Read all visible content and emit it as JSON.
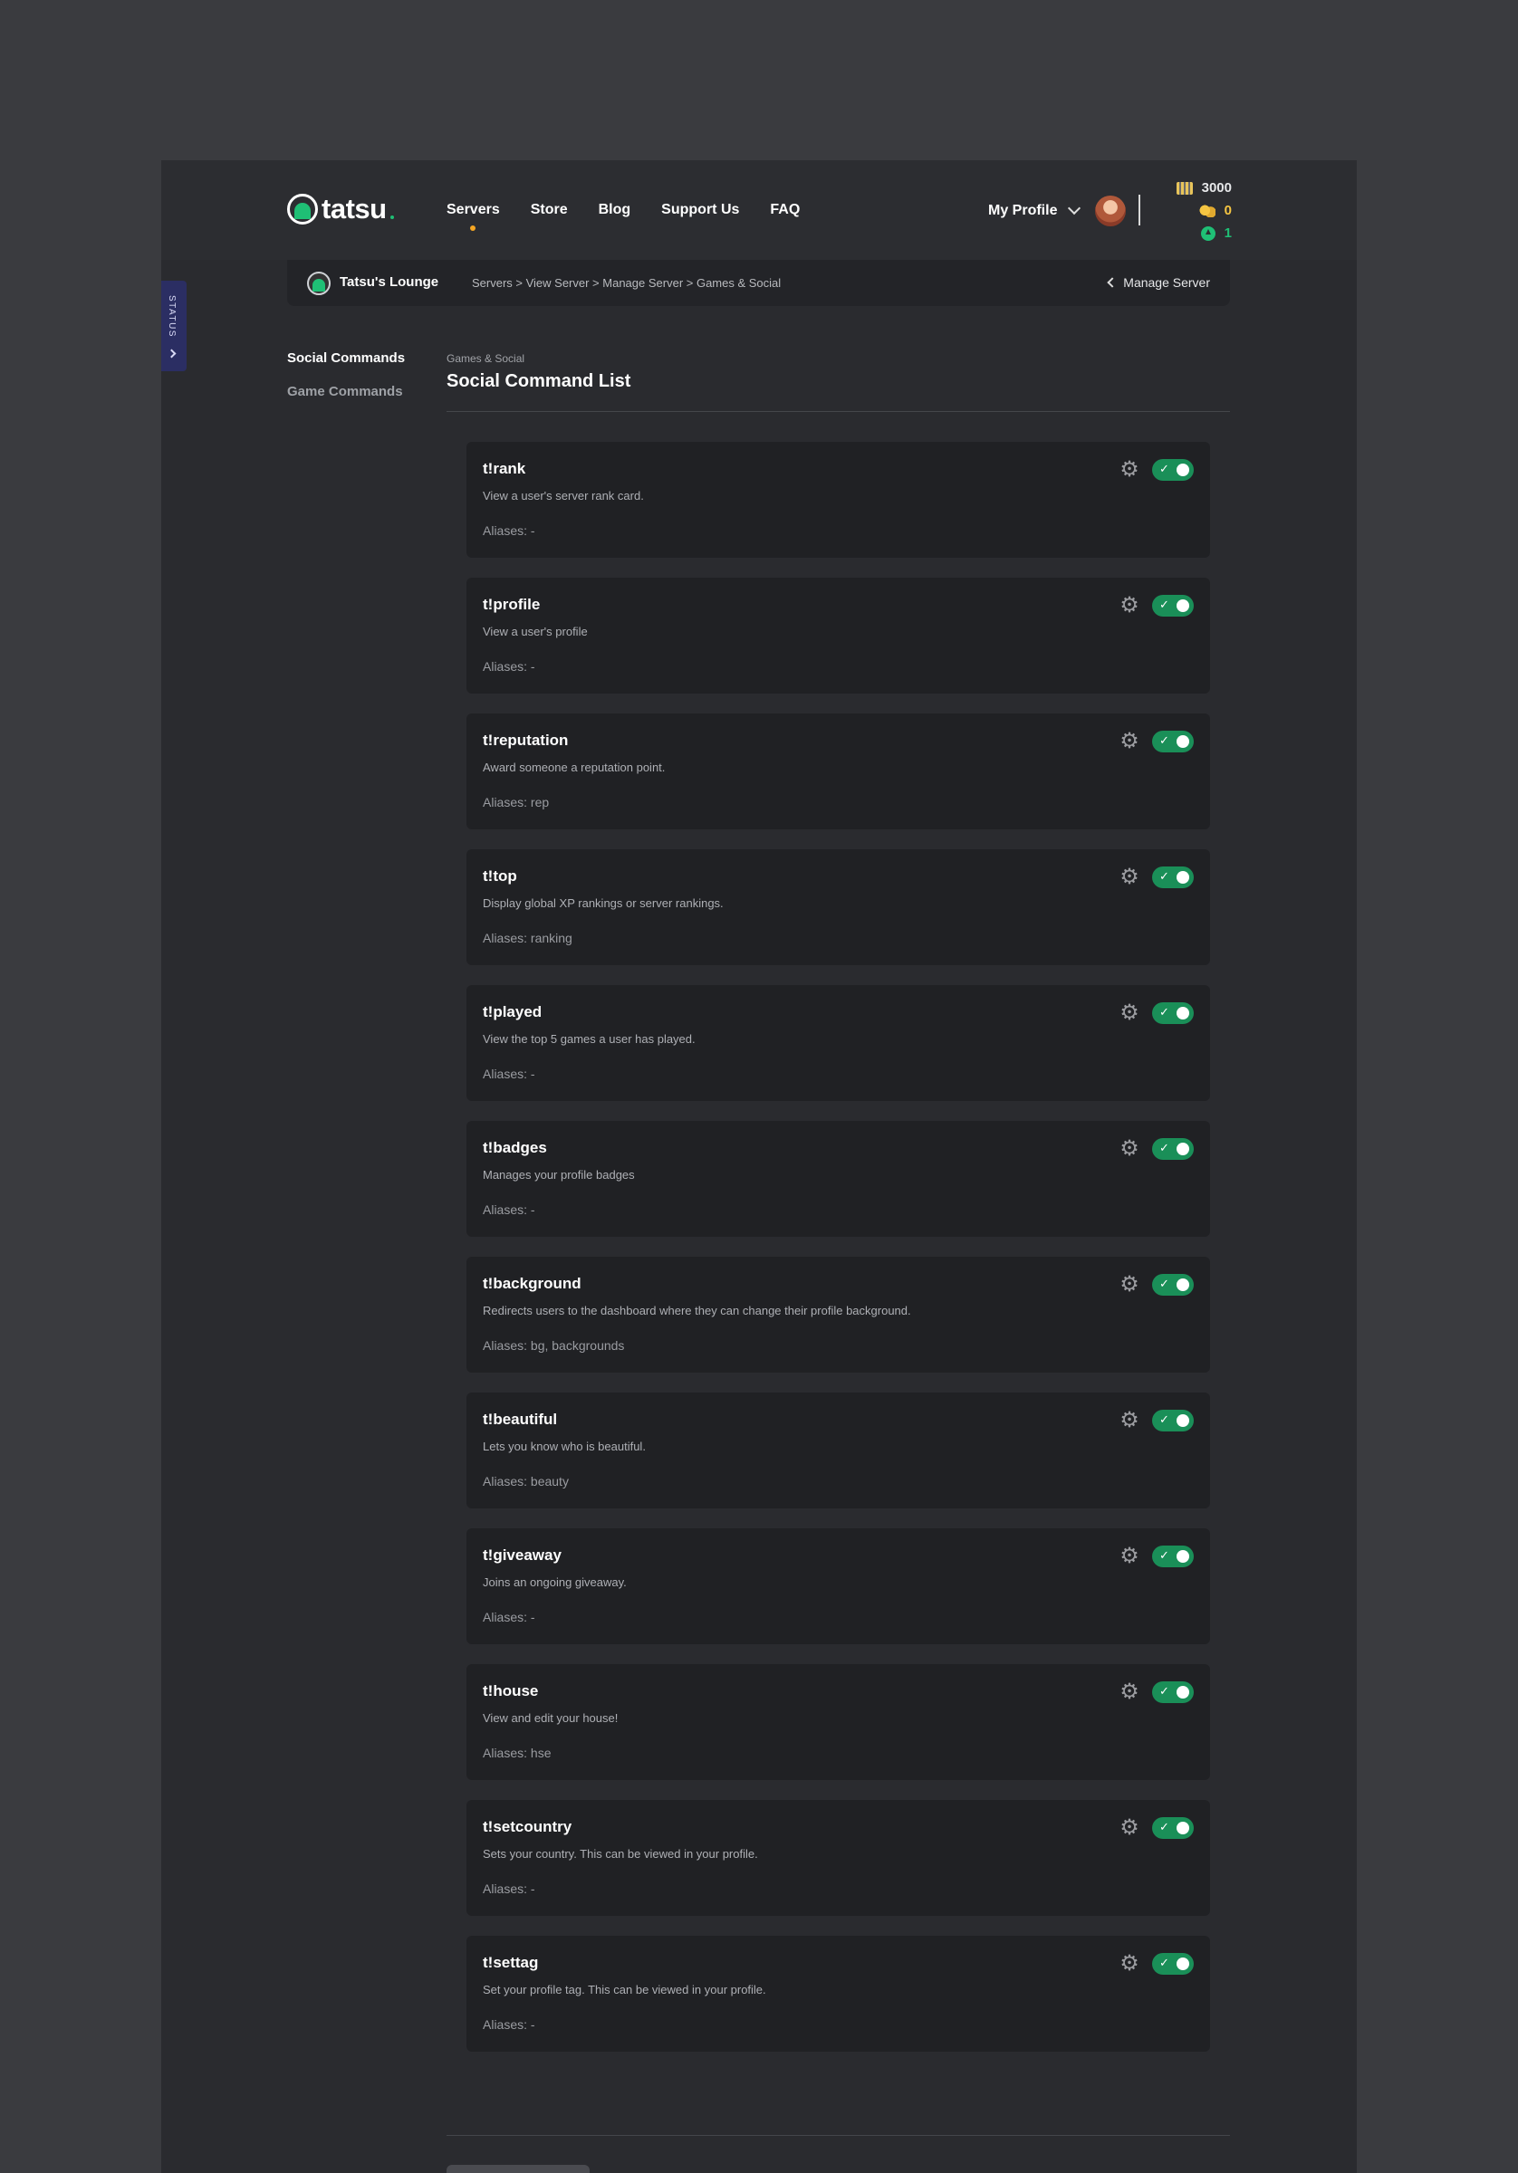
{
  "brand": {
    "name": "tatsu"
  },
  "nav": [
    {
      "label": "Servers",
      "active": true
    },
    {
      "label": "Store"
    },
    {
      "label": "Blog"
    },
    {
      "label": "Support Us"
    },
    {
      "label": "FAQ"
    }
  ],
  "profile": {
    "label": "My Profile"
  },
  "currency": {
    "cash": "3000",
    "coins": "0",
    "gems": "1",
    "cash_color": "#e6e7e9",
    "coins_color": "#f5c542",
    "gems_color": "#1fbf75"
  },
  "server": {
    "name": "Tatsu's Lounge"
  },
  "breadcrumb": {
    "path": "Servers > View Server > Manage Server > Games & Social",
    "back_label": "Manage Server"
  },
  "status_tab": {
    "label": "STATUS"
  },
  "sidemenu": [
    {
      "label": "Social Commands",
      "active": true
    },
    {
      "label": "Game Commands"
    }
  ],
  "section": {
    "kicker": "Games & Social",
    "title": "Social Command List"
  },
  "commands": [
    {
      "name": "t!rank",
      "desc": "View a user's server rank card.",
      "aliases": "Aliases: -"
    },
    {
      "name": "t!profile",
      "desc": "View a user's profile",
      "aliases": "Aliases: -"
    },
    {
      "name": "t!reputation",
      "desc": "Award someone a reputation point.",
      "aliases": "Aliases: rep"
    },
    {
      "name": "t!top",
      "desc": "Display global XP rankings or server rankings.",
      "aliases": "Aliases: ranking"
    },
    {
      "name": "t!played",
      "desc": "View the top 5 games a user has played.",
      "aliases": "Aliases: -"
    },
    {
      "name": "t!badges",
      "desc": "Manages your profile badges",
      "aliases": "Aliases: -"
    },
    {
      "name": "t!background",
      "desc": "Redirects users to the dashboard where they can change their profile background.",
      "aliases": "Aliases: bg, backgrounds"
    },
    {
      "name": "t!beautiful",
      "desc": "Lets you know who is beautiful.",
      "aliases": "Aliases: beauty"
    },
    {
      "name": "t!giveaway",
      "desc": "Joins an ongoing giveaway.",
      "aliases": "Aliases: -"
    },
    {
      "name": "t!house",
      "desc": "View and edit your house!",
      "aliases": "Aliases: hse"
    },
    {
      "name": "t!setcountry",
      "desc": "Sets your country. This can be viewed in your profile.",
      "aliases": "Aliases: -"
    },
    {
      "name": "t!settag",
      "desc": "Set your profile tag. This can be viewed in your profile.",
      "aliases": "Aliases: -"
    }
  ],
  "toggle": {
    "on_color": "#1a8f58",
    "check": "✓"
  },
  "icons": {
    "gear": "gear-icon",
    "toggle": "toggle-switch"
  }
}
